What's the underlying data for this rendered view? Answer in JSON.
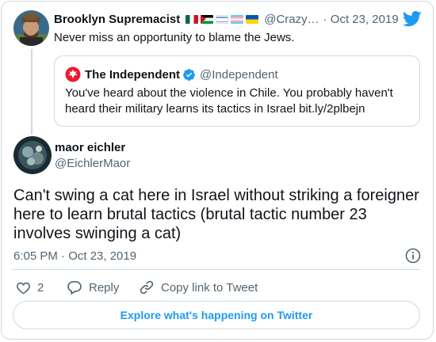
{
  "parent_tweet": {
    "author_name": "Brooklyn Supremacist",
    "flag_icons": [
      "mexico-flag",
      "palestine-flag",
      "israel-flag",
      "transgender-flag",
      "ukraine-flag"
    ],
    "handle": "@Crazy…",
    "date": "· Oct 23, 2019",
    "text": "Never miss an opportunity to blame the Jews."
  },
  "quoted_tweet": {
    "author_name": "The Independent",
    "handle": "@Independent",
    "text": "You've heard about the violence in Chile. You probably haven't heard their military learns its tactics in Israel bit.ly/2plbejn"
  },
  "main_tweet": {
    "author_name": "maor eichler",
    "handle": "@EichlerMaor",
    "text": "Can't swing a cat here in Israel without striking a foreigner here to learn brutal tactics (brutal tactic number 23 involves swinging a cat)",
    "timestamp": "6:05 PM · Oct 23, 2019"
  },
  "actions": {
    "like_count": "2",
    "reply_label": "Reply",
    "copy_link_label": "Copy link to Tweet"
  },
  "explore_label": "Explore what's happening on Twitter",
  "colors": {
    "accent": "#1d9bf0",
    "like_red": "#e0245e",
    "muted": "#536471",
    "border": "#cfd9de"
  }
}
